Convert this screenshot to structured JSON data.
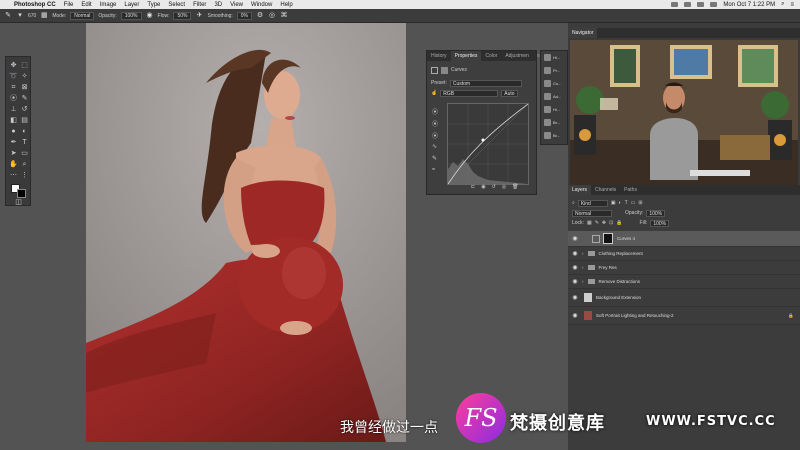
{
  "menubar": {
    "app_name": "Photoshop CC",
    "items": [
      "File",
      "Edit",
      "Image",
      "Layer",
      "Type",
      "Select",
      "Filter",
      "3D",
      "View",
      "Window",
      "Help"
    ],
    "clock": "Mon Oct 7  1:22 PM"
  },
  "options_bar": {
    "mode_label": "Mode:",
    "mode_value": "Normal",
    "opacity_label": "Opacity:",
    "opacity_value": "100%",
    "flow_label": "Flow:",
    "flow_value": "50%",
    "smoothing_label": "Smoothing:",
    "smoothing_value": "0%",
    "brush_size": "670"
  },
  "properties": {
    "tabs": [
      "History",
      "Properties",
      "Color",
      "Adjustmen"
    ],
    "active_tab": "Properties",
    "adjustment_name": "Curves",
    "preset_label": "Preset:",
    "preset_value": "Custom",
    "channel_value": "RGB",
    "auto_label": "Auto"
  },
  "icon_column": {
    "items": [
      "Hi...",
      "Pr...",
      "Co...",
      "Ad...",
      "Hi...",
      "Br...",
      "Br..."
    ]
  },
  "navigator": {
    "tab": "Navigator"
  },
  "layers": {
    "tabs": [
      "Layers",
      "Channels",
      "Paths"
    ],
    "filter_value": "Kind",
    "blend_mode": "Normal",
    "opacity_label": "Opacity:",
    "opacity_value": "100%",
    "lock_label": "Lock:",
    "fill_label": "Fill:",
    "fill_value": "100%",
    "rows": [
      {
        "name": "Curves 4",
        "type": "adjustment"
      },
      {
        "name": "Clothing Replacement",
        "type": "folder"
      },
      {
        "name": "Frey Res",
        "type": "folder"
      },
      {
        "name": "Remove Distractions",
        "type": "folder"
      },
      {
        "name": "Background Extension",
        "type": "pixel"
      },
      {
        "name": "Soft Portrait Lighting and Retouching-2",
        "type": "pixel"
      }
    ]
  },
  "overlay": {
    "subtitle": "我曾经做过一点",
    "logo_text": "FS",
    "brand_name": "梵摄创意库",
    "brand_url": "WWW.FSTVC.CC"
  },
  "colors": {
    "dress": "#9a2a27",
    "backdrop": "#a29c9a",
    "panel_bg": "#3c3c3c",
    "accent": "#ff3d9a"
  }
}
